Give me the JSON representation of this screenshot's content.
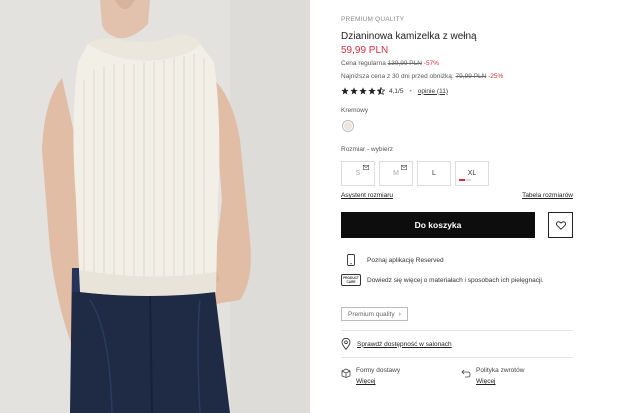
{
  "product": {
    "eyebrow": "PREMIUM QUALITY",
    "title": "Dzianinowa kamizelka z wełną",
    "price": "59,99 PLN",
    "regular_label": "Cena regularna",
    "regular_price": "139,99 PLN",
    "regular_discount": "-57%",
    "lowest_label": "Najniższa cena z 30 dni przed obniżką:",
    "lowest_price": "79,99 PLN",
    "lowest_discount": "-25%",
    "rating_score": "4,1/5",
    "rating_stars": 4.1,
    "rating_dot": "•",
    "reviews_link": "opinie (11)",
    "color_name": "Kremowy",
    "color_hex": "#efe5dc"
  },
  "sizes": {
    "label": "Rozmiar -  wybierz",
    "options": [
      {
        "label": "S",
        "available": false
      },
      {
        "label": "M",
        "available": false
      },
      {
        "label": "L",
        "available": true
      },
      {
        "label": "XL",
        "available": true,
        "low_stock": true
      }
    ],
    "assistant_link": "Asystent rozmiaru",
    "table_link": "Tabela rozmiarów"
  },
  "actions": {
    "add_to_cart": "Do koszyka",
    "favorite_icon": "heart-icon"
  },
  "info": {
    "app_text": "Poznaj aplikację Reserved",
    "care_text": "Dowiedz się więcej o materiałach i sposobach ich pielęgnacji.",
    "care_badge_line1": "PRODUCT",
    "care_badge_line2": "CARE",
    "premium_button": "Premium quality",
    "store_link": "Sprawdź dostępność w salonach"
  },
  "footer": {
    "delivery_title": "Formy dostawy",
    "delivery_link": "Więcej",
    "returns_title": "Polityka zwrotów",
    "returns_link": "Więcej"
  },
  "colors": {
    "accent_red": "#d6303d",
    "button_black": "#0d0d0d"
  }
}
